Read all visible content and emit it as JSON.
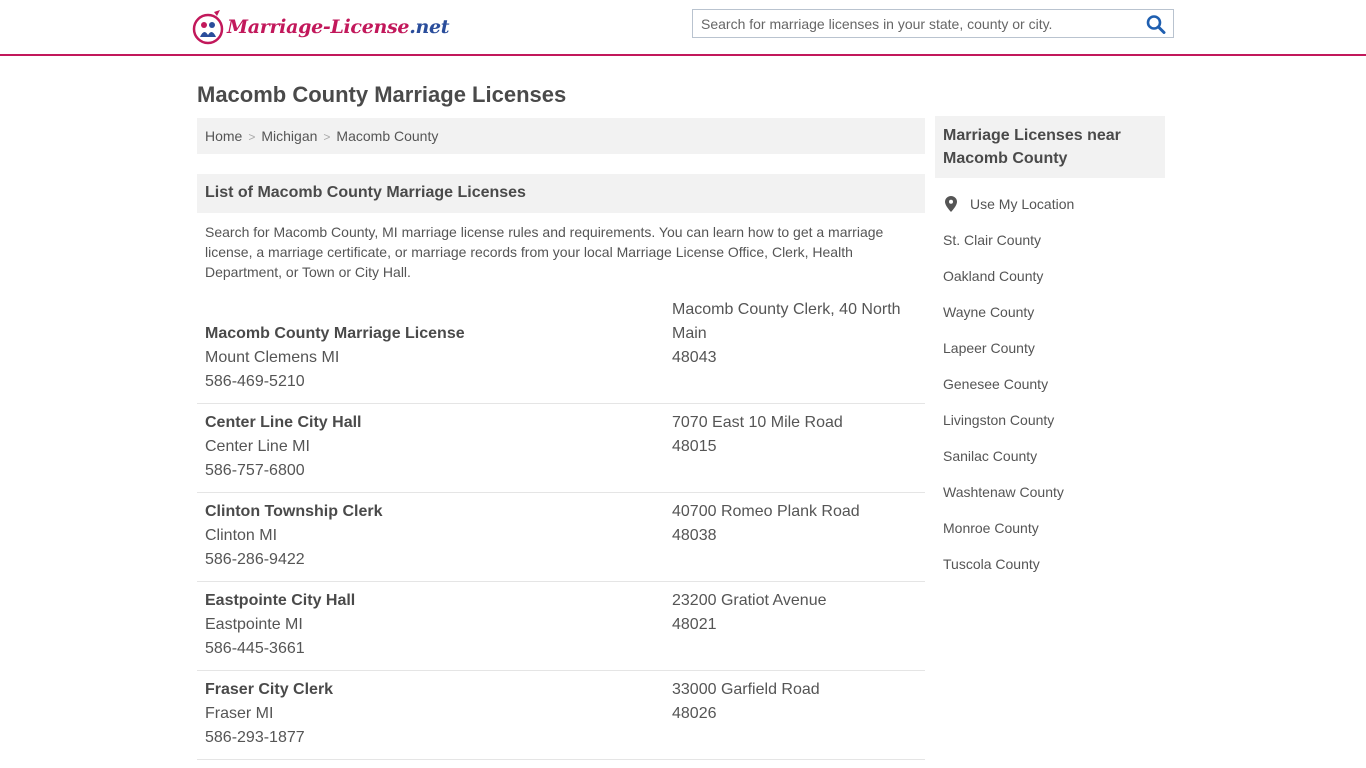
{
  "header": {
    "logo_text_main": "Marriage-License",
    "logo_text_tld": ".net",
    "search_placeholder": "Search for marriage licenses in your state, county or city.",
    "brand_color": "#c2185b"
  },
  "page": {
    "title": "Macomb County Marriage Licenses"
  },
  "breadcrumb": [
    {
      "label": "Home"
    },
    {
      "label": "Michigan"
    },
    {
      "label": "Macomb County"
    }
  ],
  "breadcrumb_separator": ">",
  "section": {
    "heading": "List of Macomb County Marriage Licenses",
    "intro": "Search for Macomb County, MI marriage license rules and requirements. You can learn how to get a marriage license, a marriage certificate, or marriage records from your local Marriage License Office, Clerk, Health Department, or Town or City Hall."
  },
  "listings": [
    {
      "name": "Macomb County Marriage License",
      "city": "Mount Clemens MI",
      "phone": "586-469-5210",
      "address_line1": "Macomb County Clerk, 40 North",
      "address_line2": "Main",
      "zip": "48043"
    },
    {
      "name": "Center Line City Hall",
      "city": "Center Line MI",
      "phone": "586-757-6800",
      "address_line1": "7070 East 10 Mile Road",
      "zip": "48015"
    },
    {
      "name": "Clinton Township Clerk",
      "city": "Clinton MI",
      "phone": "586-286-9422",
      "address_line1": "40700 Romeo Plank Road",
      "zip": "48038"
    },
    {
      "name": "Eastpointe City Hall",
      "city": "Eastpointe MI",
      "phone": "586-445-3661",
      "address_line1": "23200 Gratiot Avenue",
      "zip": "48021"
    },
    {
      "name": "Fraser City Clerk",
      "city": "Fraser MI",
      "phone": "586-293-1877",
      "address_line1": "33000 Garfield Road",
      "zip": "48026"
    }
  ],
  "sidebar": {
    "heading": "Marriage Licenses near Macomb County",
    "use_location": "Use My Location",
    "counties": [
      "St. Clair County",
      "Oakland County",
      "Wayne County",
      "Lapeer County",
      "Genesee County",
      "Livingston County",
      "Sanilac County",
      "Washtenaw County",
      "Monroe County",
      "Tuscola County"
    ]
  }
}
